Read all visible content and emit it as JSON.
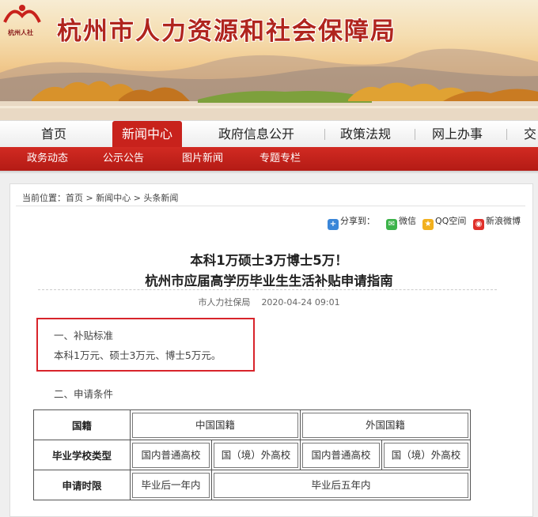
{
  "header": {
    "logo_text": "杭州人社",
    "site_title": "杭州市人力资源和社会保障局"
  },
  "main_nav": [
    {
      "label": "首页",
      "active": false
    },
    {
      "label": "新闻中心",
      "active": true
    },
    {
      "label": "政府信息公开",
      "active": false
    },
    {
      "label": "政策法规",
      "active": false
    },
    {
      "label": "网上办事",
      "active": false
    },
    {
      "label": "交",
      "active": false
    }
  ],
  "sub_nav": [
    "政务动态",
    "公示公告",
    "图片新闻",
    "专题专栏"
  ],
  "breadcrumb": "当前位置：首页 > 新闻中心 > 头条新闻",
  "share": {
    "label": "分享到：",
    "targets": [
      {
        "label": "微信",
        "color": "#3db34a"
      },
      {
        "label": "QQ空间",
        "color": "#f2b01e"
      },
      {
        "label": "新浪微博",
        "color": "#e0302a"
      }
    ]
  },
  "article": {
    "title_line1": "本科1万硕士3万博士5万！",
    "title_line2": "杭州市应届高学历毕业生生活补贴申请指南",
    "source": "市人力社保局",
    "date": "2020-04-24 09:01",
    "section1_heading": "一、补贴标准",
    "section1_body": "本科1万元、硕士3万元、博士5万元。",
    "section2_heading": "二、申请条件"
  },
  "table": {
    "row1": {
      "header": "国籍",
      "col_a": "中国国籍",
      "col_b": "外国国籍"
    },
    "row2": {
      "header": "毕业学校类型",
      "c1": "国内普通高校",
      "c2": "国（境）外高校",
      "c3": "国内普通高校",
      "c4": "国（境）外高校"
    },
    "row3": {
      "header": "申请时限",
      "c1": "毕业后一年内",
      "c2": "毕业后五年内"
    }
  },
  "colors": {
    "brand_red": "#c8221c",
    "highlight_border": "#d8242b"
  }
}
